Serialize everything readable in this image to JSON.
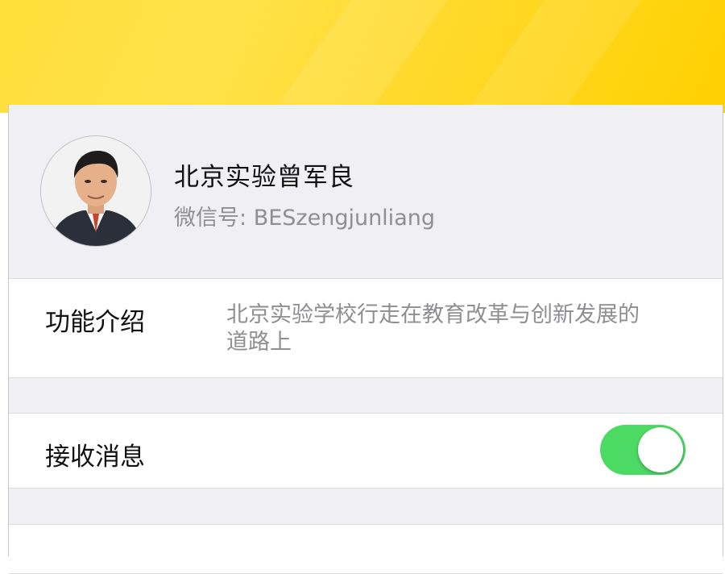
{
  "profile": {
    "name": "北京实验曾军良",
    "wechat_id_label": "微信号:",
    "wechat_id": "BESzengjunliang"
  },
  "intro_row": {
    "label": "功能介绍",
    "text_line1": "北京实验学校行走在教育改革与创新发展的",
    "text_line2": "道路上"
  },
  "receive_row": {
    "label": "接收消息",
    "toggle_on": true
  },
  "colors": {
    "banner": "#ffd92a",
    "toggle_on": "#4cd964",
    "secondary_text": "#8e8e93",
    "background": "#efeff4"
  }
}
